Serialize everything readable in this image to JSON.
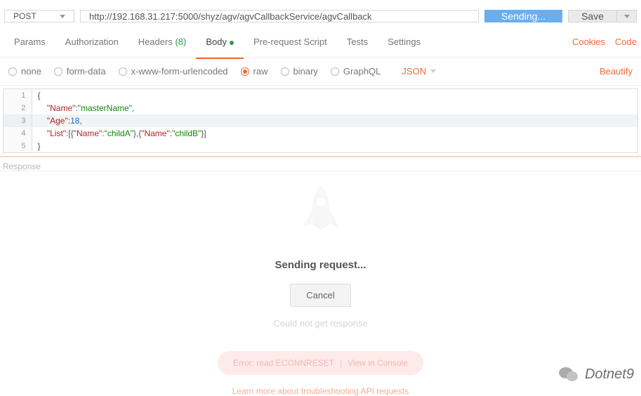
{
  "request": {
    "method": "POST",
    "url": "http://192.168.31.217:5000/shyz/agv/agvCallbackService/agvCallback",
    "send_label": "Sending...",
    "save_label": "Save"
  },
  "tabs": {
    "params": "Params",
    "auth": "Authorization",
    "headers": "Headers",
    "headers_count": "(8)",
    "body": "Body",
    "prereq": "Pre-request Script",
    "tests": "Tests",
    "settings": "Settings",
    "cookies": "Cookies",
    "code": "Code"
  },
  "body_opts": {
    "none": "none",
    "formdata": "form-data",
    "xwww": "x-www-form-urlencoded",
    "raw": "raw",
    "binary": "binary",
    "graphql": "GraphQL",
    "type": "JSON",
    "beautify": "Beautify"
  },
  "editor_lines": [
    {
      "n": "1",
      "raw": "{"
    },
    {
      "n": "2",
      "raw": "    \"Name\":\"masterName\","
    },
    {
      "n": "3",
      "raw": "    \"Age\":18,"
    },
    {
      "n": "4",
      "raw": "    \"List\":[{\"Name\":\"childA\"},{\"Name\":\"childB\"}]"
    },
    {
      "n": "5",
      "raw": "}"
    }
  ],
  "response": {
    "section_label": "Response",
    "status": "Sending request...",
    "cancel": "Cancel",
    "could_not": "Could not get response",
    "error": "Error: read ECONNRESET",
    "view_console": "View in Console",
    "learn": "Learn more about troubleshooting API requests"
  },
  "watermark": "Dotnet9"
}
